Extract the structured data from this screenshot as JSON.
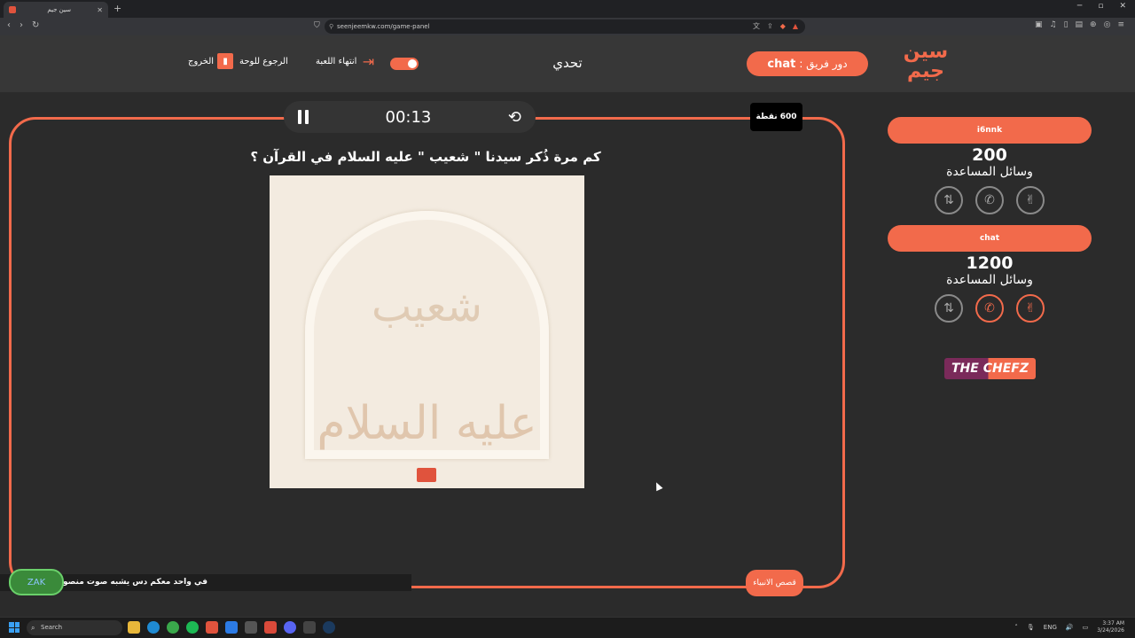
{
  "browser": {
    "tab_title": "سين جيم",
    "url": "seenjeemkw.com/game-panel"
  },
  "header": {
    "logo_text_top": "سين",
    "logo_text_bottom": "جيم",
    "team_turn_label": "دور فريق :",
    "team_turn_name": "chat",
    "title": "تحدي",
    "end_game_label": "انتهاء اللعبة",
    "back_to_board_label": "الرجوع للوحة",
    "exit_label": "الخروج"
  },
  "game": {
    "timer": "00:13",
    "points": "600 نقطة",
    "question": "كم مرة ذُكر سيدنا \" شعيب \" عليه السلام في القرآن ؟",
    "image_text_line1": "شعيب",
    "image_text_line2": "عليه السلام",
    "category": "قصص الانبياء"
  },
  "teams": [
    {
      "name": "i6nnk",
      "score": "200",
      "aids_label": "وسائل المساعدة",
      "lifelines_active": [
        false,
        false,
        false
      ]
    },
    {
      "name": "chat",
      "score": "1200",
      "aids_label": "وسائل المساعدة",
      "lifelines_active": [
        false,
        true,
        true
      ]
    }
  ],
  "sponsor": {
    "text": "THE CHEFZ"
  },
  "stream": {
    "ticker": "في واحد معكم دس يشبه صوت منصور :",
    "overlay_logo": "ZAK"
  },
  "taskbar": {
    "search_placeholder": "Search",
    "lang": "ENG",
    "time": "3:37 AM",
    "date": "3/24/2026"
  },
  "colors": {
    "accent": "#f26a4b",
    "background": "#2b2b2b",
    "header": "#373737"
  }
}
